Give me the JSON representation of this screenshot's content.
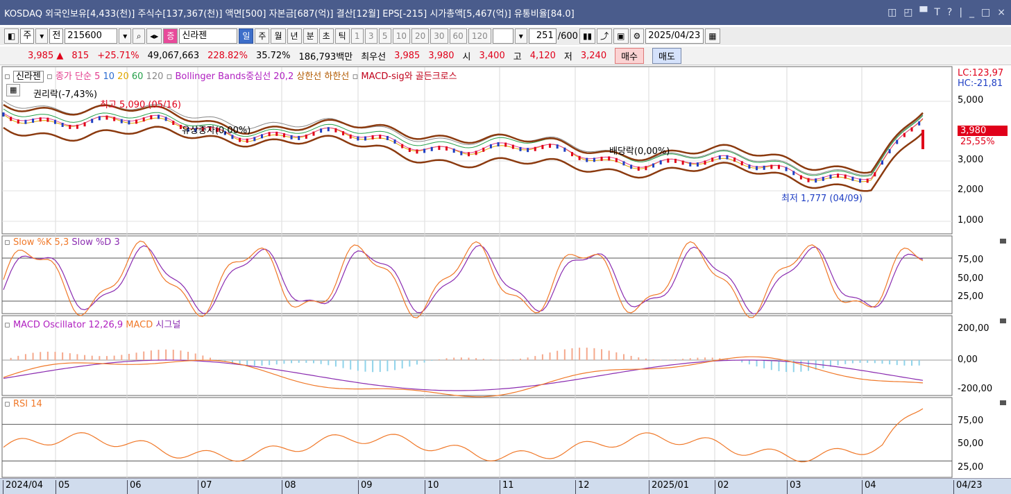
{
  "title_bar": {
    "text": "KOSDAQ 외국인보유[4,433(천)] 주식수[137,367(천)] 액면[500] 자본금[687(억)] 결산[12월] EPS[-215] 시가총액[5,467(억)] 유통비율[84.0]",
    "buttons": [
      "◫",
      "◰",
      "▀",
      "T",
      "?",
      "|",
      "_",
      "□",
      "×"
    ]
  },
  "toolbar": {
    "item_code": "215600",
    "prefix": "전",
    "item_type": "주",
    "badge": "증",
    "item_name": "신라젠",
    "periods": [
      "일",
      "주",
      "월",
      "년",
      "분",
      "초",
      "틱"
    ],
    "active_period": "일",
    "intervals": [
      "1",
      "3",
      "5",
      "10",
      "20",
      "30",
      "60",
      "120"
    ],
    "count": "251",
    "count_max": "/600",
    "date": "2025/04/23"
  },
  "quote": {
    "price": "3,985 ▲",
    "change": "815",
    "change_pct": "+25.71%",
    "volume": "49,067,663",
    "vol_ratio": "228.82%",
    "turnover": "35.72%",
    "amount": "186,793백만",
    "best_ask_label": "최우선",
    "best_ask": "3,985",
    "best_bid": "3,980",
    "open_label": "시",
    "open": "3,400",
    "high_label": "고",
    "high": "4,120",
    "low_label": "저",
    "low": "3,240",
    "buy": "매수",
    "sell": "매도"
  },
  "price_panel": {
    "stock_tag": "신라젠",
    "ma_label": "종가 단순",
    "ma": [
      "5",
      "10",
      "20",
      "60",
      "120"
    ],
    "bb": "Bollinger Bands중심선 20,2",
    "bb_upper": "상한선",
    "bb_lower": "하한선",
    "macd_sig": "MACD-sig와 골든크로스",
    "lc": "LC:123,97",
    "hc": "HC:-21,81",
    "y_ticks": [
      "5,000",
      "3,000",
      "2,000",
      "1,000"
    ],
    "last_price": "3,980",
    "last_pct": "25,55%",
    "ann_rights": "권리락(-7,43%)",
    "ann_high": "최고 5,090 (05/16)",
    "ann_capital": "유상증자(0,00%)",
    "ann_dividend": "배당락(0,00%)",
    "ann_low": "최저 1,777 (04/09)"
  },
  "stoch_panel": {
    "label_k": "Slow %K 5,3",
    "label_d": "Slow %D 3",
    "y_ticks": [
      "75,00",
      "50,00",
      "25,00"
    ]
  },
  "macd_panel": {
    "label_osc": "MACD Oscillator 12,26,9",
    "label_macd": "MACD",
    "label_sig": "시그널",
    "y_ticks": [
      "200,00",
      "0,00",
      "-200,00"
    ]
  },
  "rsi_panel": {
    "label": "RSI 14",
    "y_ticks": [
      "75,00",
      "50,00",
      "25,00"
    ]
  },
  "x_axis": [
    "2024/04",
    "05",
    "06",
    "07",
    "08",
    "09",
    "10",
    "11",
    "12",
    "2025/01",
    "02",
    "03",
    "04",
    "04/23"
  ],
  "colors": {
    "up": "#e0001a",
    "down": "#1f3fc4",
    "bb": "#8b3a0f",
    "ma5": "#e23c8c",
    "ma10": "#2a6bd1",
    "ma20": "#e0a800",
    "ma60": "#25a04a",
    "ma120": "#888888",
    "stoch_k": "#f07828",
    "stoch_d": "#8a2bb0",
    "fill_hi": "#f5a88c",
    "fill_lo": "#8fd3ea"
  }
}
